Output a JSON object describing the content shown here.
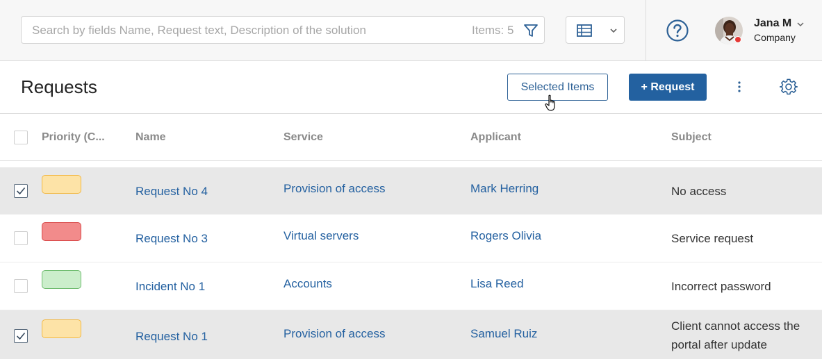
{
  "search": {
    "placeholder": "Search by fields Name, Request text, Description of the solution",
    "items_count": "Items: 5"
  },
  "user": {
    "name": "Jana M",
    "company": "Company"
  },
  "page": {
    "title": "Requests",
    "selected_items_label": "Selected Items",
    "new_request_label": "+ Request"
  },
  "table": {
    "columns": {
      "priority": "Priority (C...",
      "name": "Name",
      "service": "Service",
      "applicant": "Applicant",
      "subject": "Subject"
    },
    "rows": [
      {
        "checked": true,
        "priority_color": "#fde3a7",
        "priority_border": "#f2b844",
        "name": "Request No 4",
        "service": "Provision of access",
        "applicant": "Mark Herring",
        "subject": "No access"
      },
      {
        "checked": false,
        "priority_color": "#f28b8b",
        "priority_border": "#d94a4a",
        "name": "Request No 3",
        "service": "Virtual servers",
        "applicant": "Rogers Olivia",
        "subject": "Service request"
      },
      {
        "checked": false,
        "priority_color": "#cbeecb",
        "priority_border": "#6dbb6d",
        "name": "Incident No 1",
        "service": "Accounts",
        "applicant": "Lisa Reed",
        "subject": "Incorrect password"
      },
      {
        "checked": true,
        "priority_color": "#fde3a7",
        "priority_border": "#f2b844",
        "name": "Request No 1",
        "service": "Provision of access",
        "applicant": "Samuel Ruiz",
        "subject": "Client cannot access the portal after update"
      }
    ]
  },
  "colors": {
    "accent": "#2361a0",
    "link": "#2360a0",
    "status_dot": "#e53935"
  }
}
